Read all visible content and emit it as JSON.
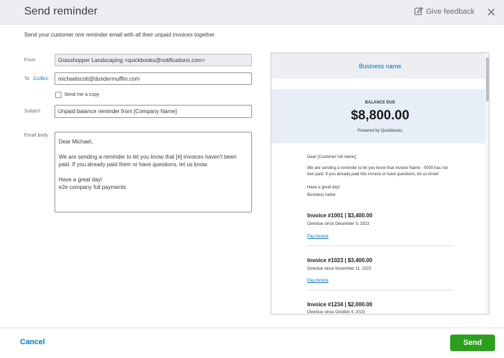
{
  "header": {
    "title": "Send reminder",
    "feedback_label": "Give feedback"
  },
  "description": "Send your customer one reminder email with all their unpaid invoices together.",
  "form": {
    "from_label": "From",
    "from_value": "Grasshopper Landscaping <quickbooks@notifications.com>",
    "to_label": "To",
    "cc_label": "Cc/Bcc",
    "to_value": "michaelscott@dundermufflin.com",
    "send_copy_label": "Send me a copy",
    "subject_label": "Subject",
    "subject_value": "Unpaid balance reminder from [Company Name]",
    "body_label": "Email body",
    "body_lines": [
      "Dear Michael,",
      "We are sending a reminder to let you know that [#] invoices haven't been paid. If you already paid them or have questions, let us know.",
      "Have a great day!",
      "e2e company full payments"
    ]
  },
  "preview": {
    "business_name": "Business name",
    "balance_label": "BALANCE DUE",
    "balance_amount": "$8,800.00",
    "powered_by": "Powered by Quickbooks",
    "greeting": "Dear [Customer full name],",
    "message_line1": "We are sending a reminder to let you know that invoice Name - 0000 has not",
    "message_line2": "ben paid. If you already paid this invoice or have questions, let us know!",
    "signoff": "Have a great day!",
    "signoff_name": "Business name",
    "invoices": [
      {
        "title": "Invoice #1001 | $3,400.00",
        "due": "Overdue since December 3, 2023",
        "pay": "Pay invoice"
      },
      {
        "title": "Invoice #1023 | $3,400.00",
        "due": "Overdue since November 11, 2023",
        "pay": "Pay invoice"
      },
      {
        "title": "Invoice #1234 | $2,000.00",
        "due": "Overdue since October 4, 2023"
      }
    ]
  },
  "footer": {
    "cancel_label": "Cancel",
    "send_label": "Send"
  },
  "colors": {
    "accent": "#0077c5",
    "primary_button": "#2ca01c"
  }
}
